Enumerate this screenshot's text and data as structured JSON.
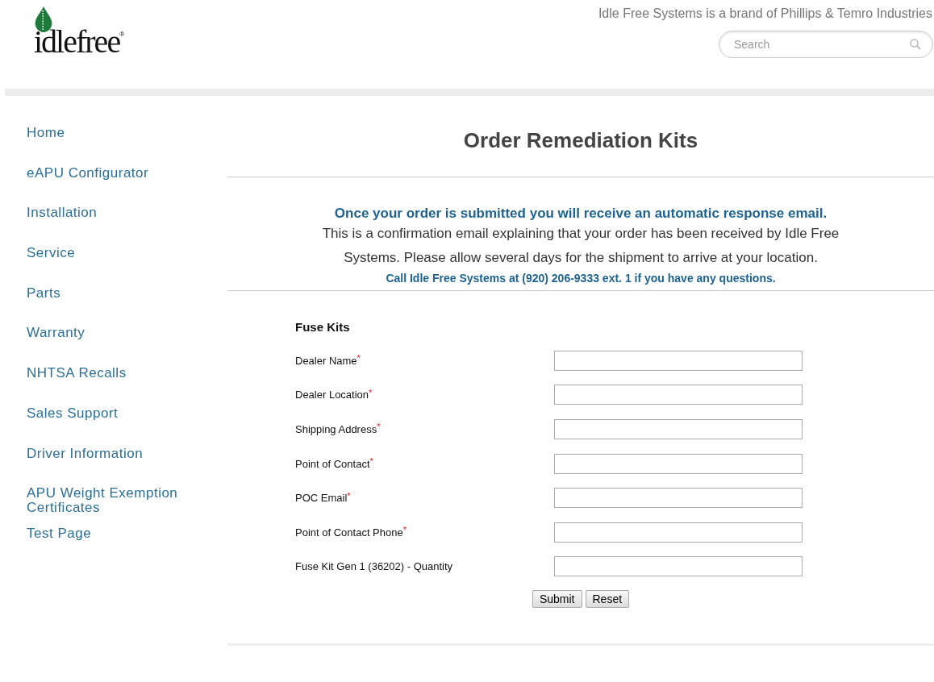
{
  "header": {
    "logo": {
      "text": "idlefree",
      "mark": "®"
    },
    "tagline": "Idle Free Systems is a brand of Phillips & Temro Industries",
    "search": {
      "placeholder": "Search"
    }
  },
  "sidebar": {
    "items": [
      {
        "label": "Home"
      },
      {
        "label": "eAPU Configurator"
      },
      {
        "label": "Installation"
      },
      {
        "label": "Service"
      },
      {
        "label": "Parts"
      },
      {
        "label": "Warranty"
      },
      {
        "label": "NHTSA Recalls"
      },
      {
        "label": "Sales Support"
      },
      {
        "label": "Driver Information"
      },
      {
        "label": "APU Weight Exemption Certificates"
      },
      {
        "label": "Test Page"
      }
    ]
  },
  "page": {
    "title": "Order Remediation Kits",
    "notice": {
      "headline": "Once your order is submitted you will receive an automatic response email.",
      "body": "This is a confirmation email explaining that your order has been received by Idle Free Systems. Please allow several days for the shipment to arrive at your location.",
      "contact": "Call Idle Free Systems at (920) 206-9333 ext. 1 if you have any questions."
    },
    "form": {
      "title": "Fuse Kits",
      "required_marker": "*",
      "fields": [
        {
          "label": "Dealer Name",
          "required": true
        },
        {
          "label": "Dealer Location",
          "required": true
        },
        {
          "label": "Shipping Address",
          "required": true
        },
        {
          "label": "Point of Contact",
          "required": true
        },
        {
          "label": "POC Email",
          "required": true
        },
        {
          "label": "Point of Contact Phone",
          "required": true
        },
        {
          "label": "Fuse Kit Gen 1 (36202) - Quantity",
          "required": false
        }
      ],
      "buttons": [
        {
          "label": "Submit"
        },
        {
          "label": "Reset"
        }
      ]
    }
  }
}
